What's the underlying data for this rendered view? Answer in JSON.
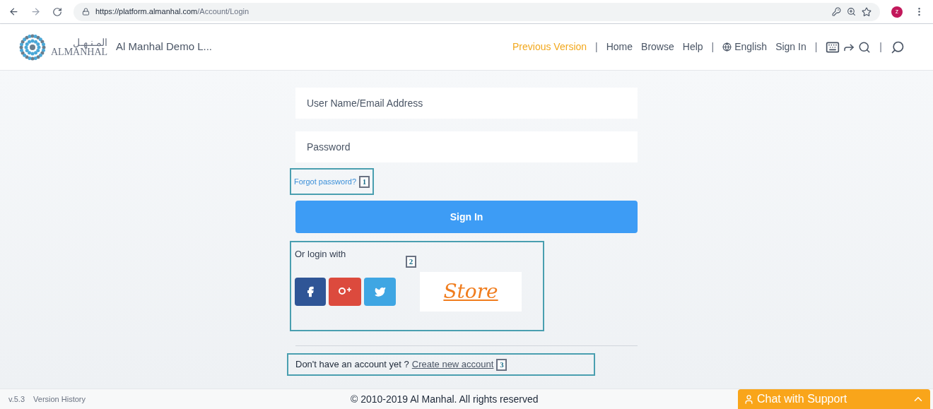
{
  "browser": {
    "url_host": "https://platform.almanhal.com",
    "url_path": "/Account/Login",
    "profile_initial": "z"
  },
  "header": {
    "logo_arabic": "المـنـهـل",
    "logo_latin": "ALMANHAL",
    "site_title": "Al Manhal Demo L...",
    "nav": [
      {
        "kind": "link",
        "label": "Previous Version",
        "highlighted": true
      },
      {
        "kind": "sep",
        "label": "|"
      },
      {
        "kind": "link",
        "label": "Home",
        "highlighted": false
      },
      {
        "kind": "link",
        "label": "Browse",
        "highlighted": false
      },
      {
        "kind": "link",
        "label": "Help",
        "highlighted": false
      },
      {
        "kind": "sep",
        "label": "|"
      },
      {
        "kind": "language",
        "label": "English",
        "highlighted": false
      },
      {
        "kind": "link",
        "label": "Sign In",
        "highlighted": false
      },
      {
        "kind": "sep",
        "label": "|"
      },
      {
        "kind": "tools"
      },
      {
        "kind": "sep",
        "label": "|"
      },
      {
        "kind": "search"
      }
    ]
  },
  "form": {
    "username": {
      "placeholder": "User Name/Email Address"
    },
    "password": {
      "placeholder": "Password"
    },
    "forgot": "Forgot password?",
    "sign_in": "Sign In",
    "or_login": "Or login with",
    "store": "Store",
    "no_account": "Don't have an account yet ?",
    "create": "Create new account"
  },
  "callouts": [
    "1",
    "2",
    "3"
  ],
  "footer": {
    "version": "v.5.3",
    "history": "Version History",
    "copyright": "© 2010-2019 Al Manhal. All rights reserved",
    "chat": "Chat with Support"
  }
}
